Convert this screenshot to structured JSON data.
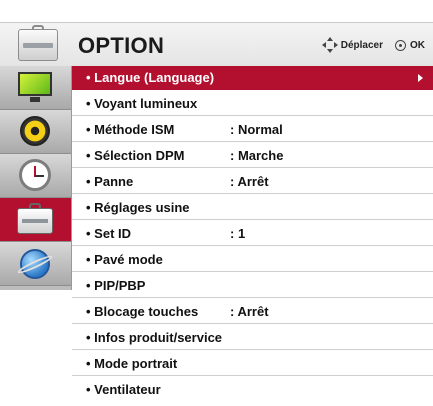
{
  "header": {
    "title": "OPTION",
    "icon": "toolbox-icon",
    "nav_hint": {
      "icon": "four-way-arrows-icon",
      "label": "Déplacer"
    },
    "ok_hint": {
      "icon": "ok-button-icon",
      "label": "OK"
    }
  },
  "colors": {
    "accent": "#b3102f",
    "sidebar": "#bcbcbc",
    "header": "#e9e9e9"
  },
  "sidebar": {
    "items": [
      {
        "icon": "monitor-icon",
        "active": false
      },
      {
        "icon": "speaker-icon",
        "active": false
      },
      {
        "icon": "clock-icon",
        "active": false
      },
      {
        "icon": "toolbox-icon",
        "active": true
      },
      {
        "icon": "globe-icon",
        "active": false
      }
    ]
  },
  "menu": {
    "items": [
      {
        "label": "• Langue (Language)",
        "value": "",
        "selected": true,
        "has_submenu": true
      },
      {
        "label": "• Voyant lumineux",
        "value": ""
      },
      {
        "label": "• Méthode ISM",
        "value": ": Normal"
      },
      {
        "label": "• Sélection DPM",
        "value": ": Marche"
      },
      {
        "label": "• Panne",
        "value": ": Arrêt"
      },
      {
        "label": "• Réglages usine",
        "value": ""
      },
      {
        "label": "• Set ID",
        "value": ": 1"
      },
      {
        "label": "• Pavé mode",
        "value": ""
      },
      {
        "label": "• PIP/PBP",
        "value": ""
      },
      {
        "label": "• Blocage touches",
        "value": ": Arrêt"
      },
      {
        "label": "• Infos produit/service",
        "value": ""
      },
      {
        "label": "• Mode portrait",
        "value": ""
      },
      {
        "label": "• Ventilateur",
        "value": ""
      }
    ]
  }
}
